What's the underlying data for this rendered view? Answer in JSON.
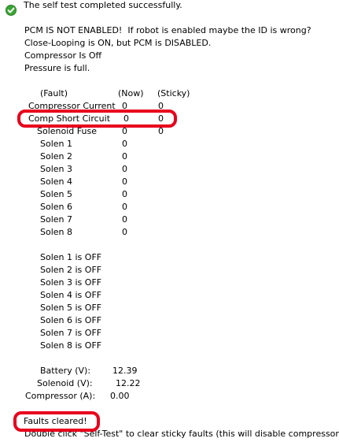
{
  "header": {
    "status_message": "The self test completed successfully.",
    "status_icon": "green-check-icon"
  },
  "messages": [
    "PCM IS NOT ENABLED!  If robot is enabled maybe the ID is wrong?",
    "Close-Looping is ON, but PCM is DISABLED.",
    "Compressor Is Off",
    "Pressure is full."
  ],
  "fault_table": {
    "headers": [
      "(Fault)",
      "(Now)",
      "(Sticky)"
    ],
    "rows": [
      {
        "name": "Compressor Current",
        "now": "0",
        "sticky": "0"
      },
      {
        "name": "Comp Short Circuit",
        "now": "0",
        "sticky": "0"
      },
      {
        "name": "Solenoid Fuse",
        "now": "0",
        "sticky": "0"
      },
      {
        "name": "Solen 1",
        "now": "0"
      },
      {
        "name": "Solen 2",
        "now": "0"
      },
      {
        "name": "Solen 3",
        "now": "0"
      },
      {
        "name": "Solen 4",
        "now": "0"
      },
      {
        "name": "Solen 5",
        "now": "0"
      },
      {
        "name": "Solen 6",
        "now": "0"
      },
      {
        "name": "Solen 7",
        "now": "0"
      },
      {
        "name": "Solen 8",
        "now": "0"
      }
    ]
  },
  "solenoid_states": [
    "Solen 1 is OFF",
    "Solen 2 is OFF",
    "Solen 3 is OFF",
    "Solen 4 is OFF",
    "Solen 5 is OFF",
    "Solen 6 is OFF",
    "Solen 7 is OFF",
    "Solen 8 is OFF"
  ],
  "readings": [
    {
      "label": "Battery (V):",
      "value": "12.39"
    },
    {
      "label": "Solenoid (V):",
      "value": "12.22"
    },
    {
      "label": "Compressor (A):",
      "value": "0.00"
    }
  ],
  "footer": {
    "faults_cleared": "Faults cleared!",
    "hint": "Double click \"Self-Test\" to clear sticky faults (this will disable compressor)"
  },
  "colors": {
    "highlight": "#e8001c",
    "check": "#3aa635"
  }
}
